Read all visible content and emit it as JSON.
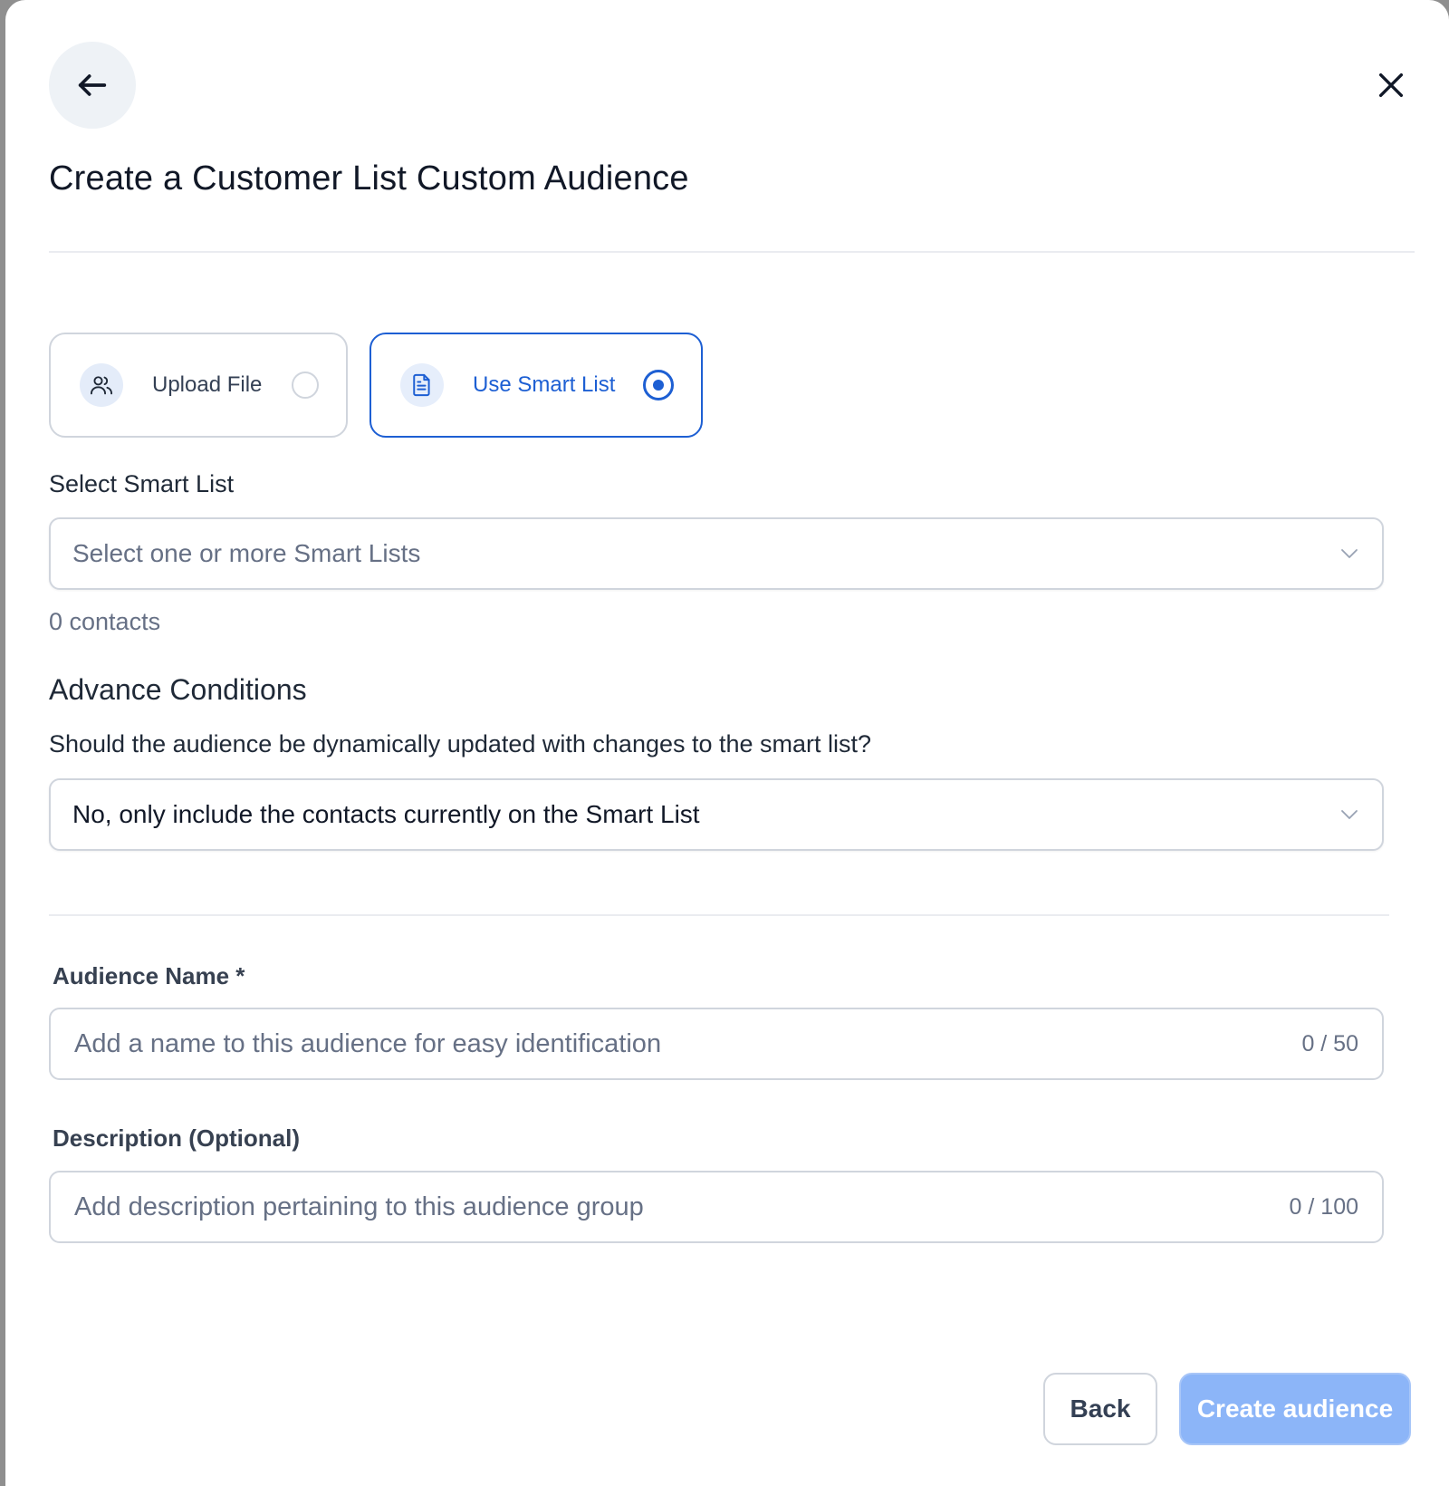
{
  "modal": {
    "title": "Create a Customer List Custom Audience"
  },
  "options": {
    "upload_label": "Upload File",
    "smart_label": "Use Smart List",
    "selected": "Use Smart List"
  },
  "smart_list": {
    "label": "Select Smart List",
    "placeholder": "Select one or more Smart Lists",
    "contacts": "0 contacts"
  },
  "advance": {
    "title": "Advance Conditions",
    "question": "Should the audience be dynamically updated with changes to the smart list?",
    "selected_value": "No, only include the contacts currently on the Smart List"
  },
  "audience_name": {
    "label": "Audience Name *",
    "placeholder": "Add a name to this audience for easy identification",
    "counter": "0 / 50"
  },
  "description": {
    "label": "Description (Optional)",
    "placeholder": "Add description pertaining to this audience group",
    "counter": "0 / 100"
  },
  "footer": {
    "back_label": "Back",
    "create_label": "Create audience"
  },
  "colors": {
    "accent": "#1d5fd3",
    "create_disabled": "#8cb5f8"
  }
}
